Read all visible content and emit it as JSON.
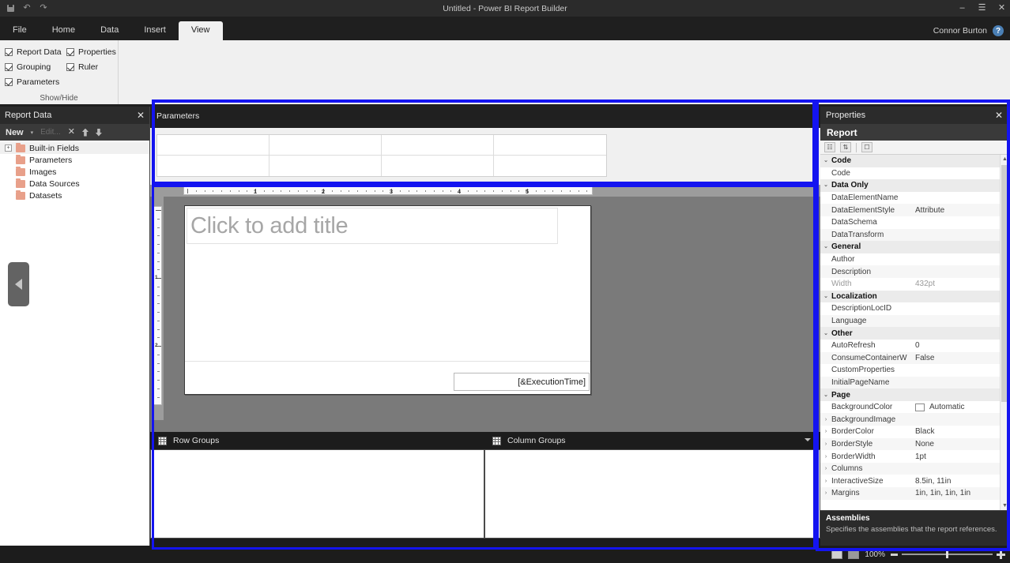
{
  "titlebar": {
    "title": "Untitled - Power BI Report Builder",
    "quick_access": [
      "save-icon",
      "undo-icon",
      "redo-icon"
    ],
    "window_buttons": [
      "minimize-icon",
      "restore-icon",
      "close-icon"
    ]
  },
  "ribbon": {
    "tabs": [
      {
        "label": "File",
        "active": false
      },
      {
        "label": "Home",
        "active": false
      },
      {
        "label": "Data",
        "active": false
      },
      {
        "label": "Insert",
        "active": false
      },
      {
        "label": "View",
        "active": true
      }
    ],
    "user_name": "Connor Burton",
    "help_label": "?",
    "group": {
      "title": "Show/Hide",
      "checkboxes": [
        {
          "label": "Report Data",
          "checked": true
        },
        {
          "label": "Properties",
          "checked": true
        },
        {
          "label": "Grouping",
          "checked": true
        },
        {
          "label": "Ruler",
          "checked": true
        },
        {
          "label": "Parameters",
          "checked": true
        }
      ]
    }
  },
  "report_data": {
    "title": "Report Data",
    "close_icon": "✕",
    "toolbar": {
      "new_label": "New",
      "caret": "▾",
      "edit_label": "Edit...",
      "delete_icon": "✕",
      "move_up_icon": "move-up-icon",
      "move_down_icon": "move-down-icon"
    },
    "tree": [
      {
        "label": "Built-in Fields",
        "expandable": true,
        "selected": true
      },
      {
        "label": "Parameters",
        "expandable": false,
        "selected": false
      },
      {
        "label": "Images",
        "expandable": false,
        "selected": false
      },
      {
        "label": "Data Sources",
        "expandable": false,
        "selected": false
      },
      {
        "label": "Datasets",
        "expandable": false,
        "selected": false
      }
    ],
    "folder_color": "#e8a08a"
  },
  "collapse_handle": {
    "icon": "left-arrow-icon"
  },
  "parameters_pane": {
    "title": "Parameters",
    "rows": 2,
    "columns": 4
  },
  "ruler": {
    "horizontal_numbers": [
      "1",
      "2",
      "3",
      "4",
      "5"
    ],
    "vertical_numbers": [
      "1",
      "2"
    ],
    "unit": "in"
  },
  "design_surface": {
    "title_placeholder": "Click to add title",
    "footer_expression": "[&ExecutionTime]"
  },
  "groups_pane": {
    "row_groups_label": "Row Groups",
    "column_groups_label": "Column Groups",
    "row_groups_items": [],
    "column_groups_items": []
  },
  "properties": {
    "title": "Properties",
    "close_icon": "✕",
    "subject": "Report",
    "toolbar_icons": [
      "categorized-icon",
      "alphabetical-icon",
      "property-pages-icon"
    ],
    "rows": [
      {
        "kind": "category",
        "name": "Code",
        "value": "",
        "expanded": true
      },
      {
        "kind": "prop",
        "name": "Code",
        "value": "",
        "dim": false,
        "expandable": false
      },
      {
        "kind": "category",
        "name": "Data Only",
        "value": "",
        "expanded": true
      },
      {
        "kind": "prop",
        "name": "DataElementName",
        "value": "",
        "dim": false,
        "expandable": false
      },
      {
        "kind": "prop",
        "name": "DataElementStyle",
        "value": "Attribute",
        "dim": false,
        "expandable": false
      },
      {
        "kind": "prop",
        "name": "DataSchema",
        "value": "",
        "dim": false,
        "expandable": false
      },
      {
        "kind": "prop",
        "name": "DataTransform",
        "value": "",
        "dim": false,
        "expandable": false
      },
      {
        "kind": "category",
        "name": "General",
        "value": "",
        "expanded": true
      },
      {
        "kind": "prop",
        "name": "Author",
        "value": "",
        "dim": false,
        "expandable": false
      },
      {
        "kind": "prop",
        "name": "Description",
        "value": "",
        "dim": false,
        "expandable": false
      },
      {
        "kind": "prop",
        "name": "Width",
        "value": "432pt",
        "dim": true,
        "expandable": false
      },
      {
        "kind": "category",
        "name": "Localization",
        "value": "",
        "expanded": true
      },
      {
        "kind": "prop",
        "name": "DescriptionLocID",
        "value": "",
        "dim": false,
        "expandable": false
      },
      {
        "kind": "prop",
        "name": "Language",
        "value": "",
        "dim": false,
        "expandable": false
      },
      {
        "kind": "category",
        "name": "Other",
        "value": "",
        "expanded": true
      },
      {
        "kind": "prop",
        "name": "AutoRefresh",
        "value": "0",
        "dim": false,
        "expandable": false
      },
      {
        "kind": "prop",
        "name": "ConsumeContainerW",
        "value": "False",
        "dim": false,
        "expandable": false
      },
      {
        "kind": "prop",
        "name": "CustomProperties",
        "value": "",
        "dim": false,
        "expandable": false
      },
      {
        "kind": "prop",
        "name": "InitialPageName",
        "value": "",
        "dim": false,
        "expandable": false
      },
      {
        "kind": "category",
        "name": "Page",
        "value": "",
        "expanded": true
      },
      {
        "kind": "prop",
        "name": "BackgroundColor",
        "value": "Automatic",
        "dim": false,
        "expandable": false,
        "swatch": "#ffffff"
      },
      {
        "kind": "prop",
        "name": "BackgroundImage",
        "value": "",
        "dim": false,
        "expandable": true
      },
      {
        "kind": "prop",
        "name": "BorderColor",
        "value": "Black",
        "dim": false,
        "expandable": true
      },
      {
        "kind": "prop",
        "name": "BorderStyle",
        "value": "None",
        "dim": false,
        "expandable": true
      },
      {
        "kind": "prop",
        "name": "BorderWidth",
        "value": "1pt",
        "dim": false,
        "expandable": true
      },
      {
        "kind": "prop",
        "name": "Columns",
        "value": "",
        "dim": false,
        "expandable": true
      },
      {
        "kind": "prop",
        "name": "InteractiveSize",
        "value": "8.5in, 11in",
        "dim": false,
        "expandable": true
      },
      {
        "kind": "prop",
        "name": "Margins",
        "value": "1in, 1in, 1in, 1in",
        "dim": false,
        "expandable": true
      }
    ],
    "description": {
      "title": "Assemblies",
      "text": "Specifies the assemblies that the report references."
    }
  },
  "statusbar": {
    "zoom_level": "100%",
    "view_icons": [
      "design-view-icon",
      "print-layout-icon"
    ]
  },
  "highlight_color": "#1414f0"
}
